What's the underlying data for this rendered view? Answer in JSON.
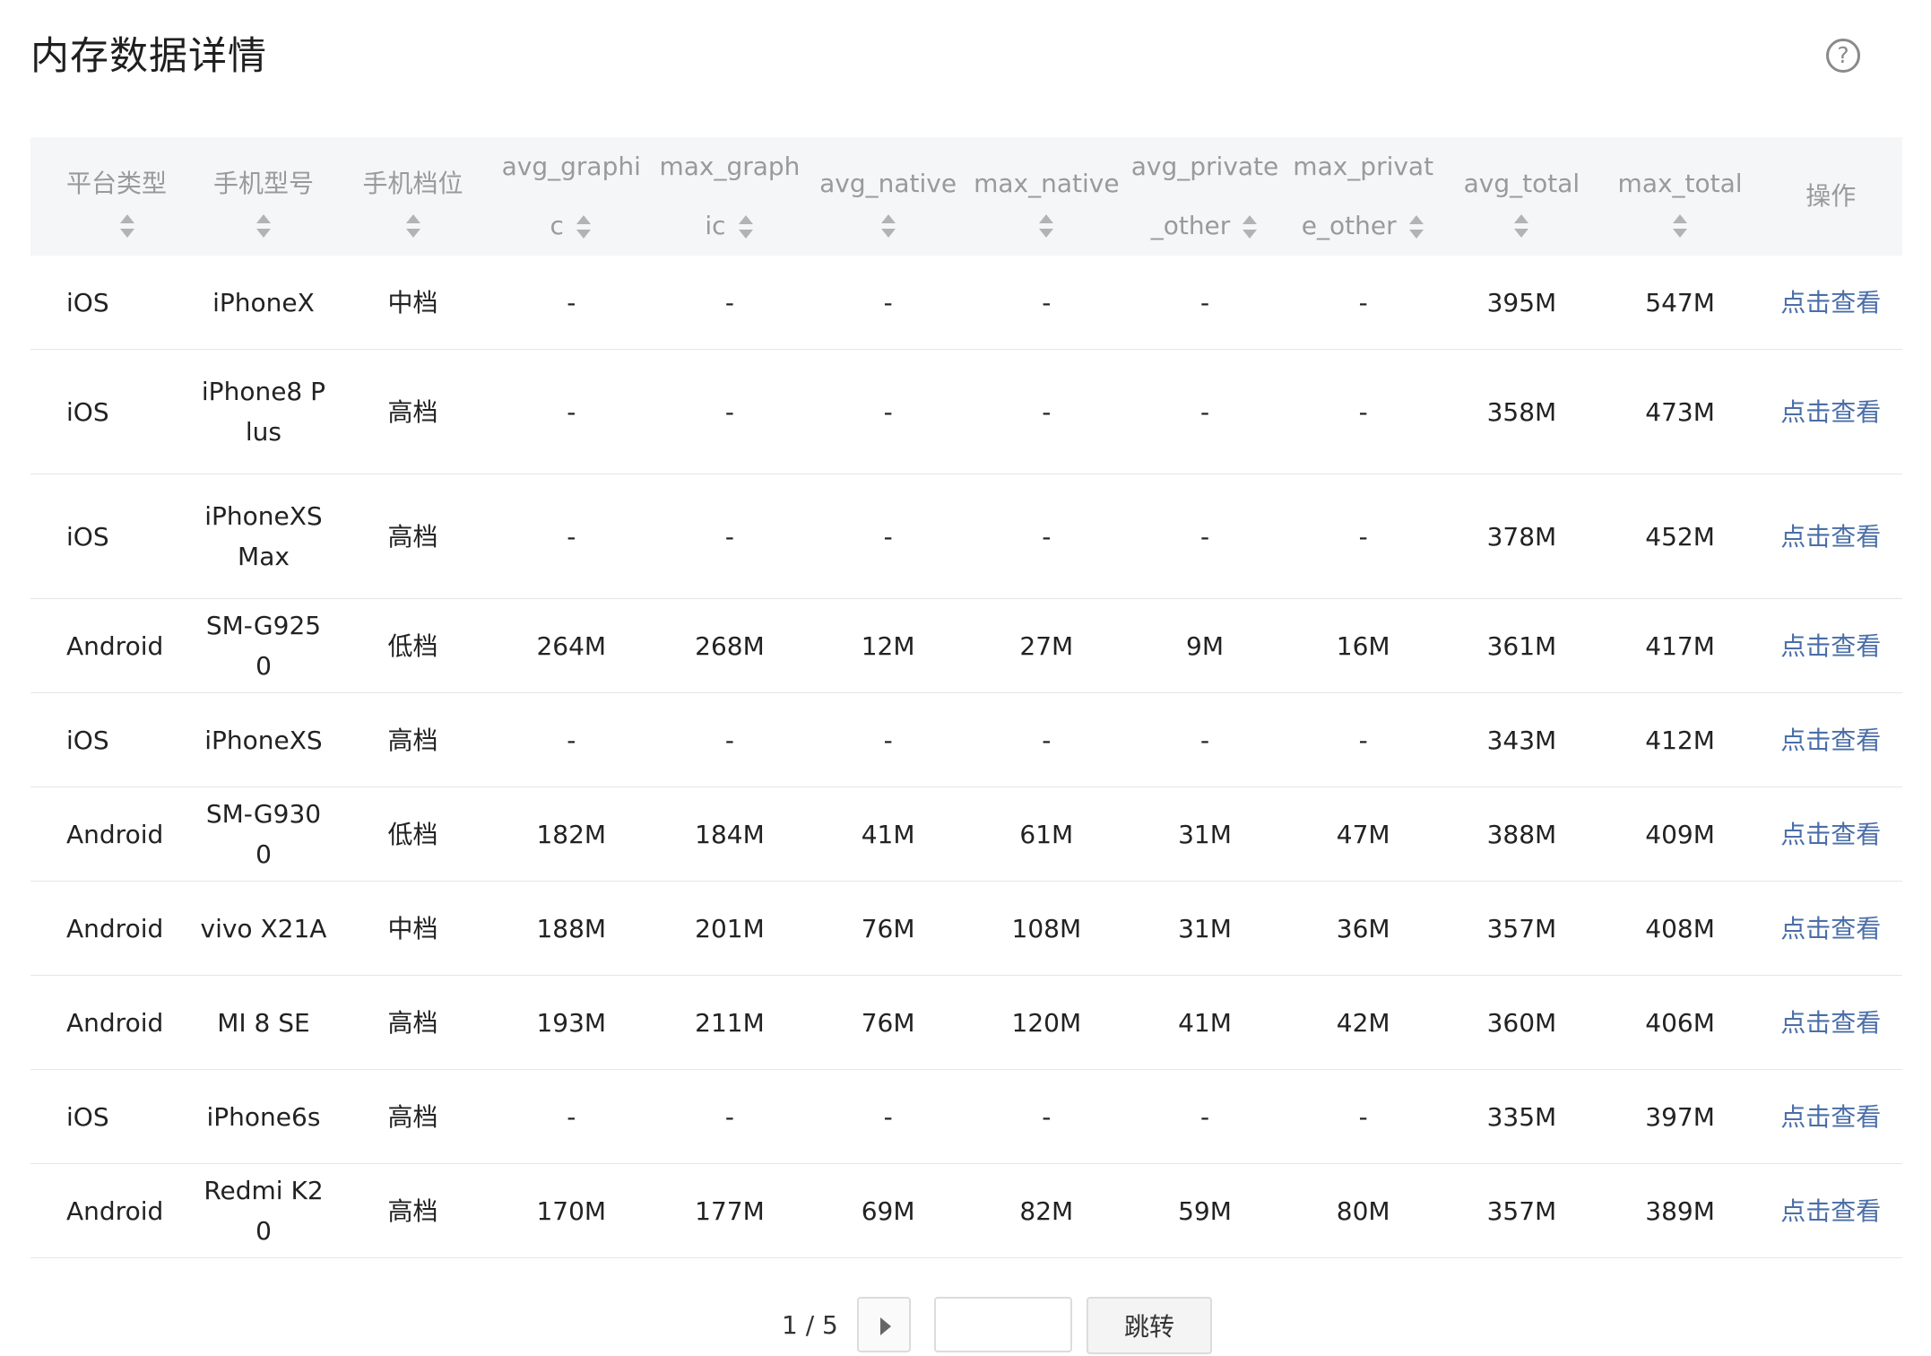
{
  "page": {
    "title": "内存数据详情"
  },
  "help_icon": {
    "glyph": "?"
  },
  "table": {
    "columns": [
      {
        "key": "platform",
        "label": "平台类型",
        "sortable": true
      },
      {
        "key": "model",
        "label": "手机型号",
        "sortable": true
      },
      {
        "key": "tier",
        "label": "手机档位",
        "sortable": true
      },
      {
        "key": "avg_graphic",
        "label": "avg_graphic",
        "sortable": true
      },
      {
        "key": "max_graphic",
        "label": "max_graphic",
        "sortable": true
      },
      {
        "key": "avg_native",
        "label": "avg_native",
        "sortable": true
      },
      {
        "key": "max_native",
        "label": "max_native",
        "sortable": true
      },
      {
        "key": "avg_private_other",
        "label": "avg_private_other",
        "sortable": true
      },
      {
        "key": "max_private_other",
        "label": "max_private_other",
        "sortable": true
      },
      {
        "key": "avg_total",
        "label": "avg_total",
        "sortable": true
      },
      {
        "key": "max_total",
        "label": "max_total",
        "sortable": true
      },
      {
        "key": "action",
        "label": "操作",
        "sortable": false
      }
    ],
    "rows": [
      [
        "iOS",
        "iPhoneX",
        "中档",
        "-",
        "-",
        "-",
        "-",
        "-",
        "-",
        "395M",
        "547M",
        "点击查看"
      ],
      [
        "iOS",
        "iPhone8 Plus",
        "高档",
        "-",
        "-",
        "-",
        "-",
        "-",
        "-",
        "358M",
        "473M",
        "点击查看"
      ],
      [
        "iOS",
        "iPhoneXS Max",
        "高档",
        "-",
        "-",
        "-",
        "-",
        "-",
        "-",
        "378M",
        "452M",
        "点击查看"
      ],
      [
        "Android",
        "SM-G9250",
        "低档",
        "264M",
        "268M",
        "12M",
        "27M",
        "9M",
        "16M",
        "361M",
        "417M",
        "点击查看"
      ],
      [
        "iOS",
        "iPhoneXS",
        "高档",
        "-",
        "-",
        "-",
        "-",
        "-",
        "-",
        "343M",
        "412M",
        "点击查看"
      ],
      [
        "Android",
        "SM-G9300",
        "低档",
        "182M",
        "184M",
        "41M",
        "61M",
        "31M",
        "47M",
        "388M",
        "409M",
        "点击查看"
      ],
      [
        "Android",
        "vivo X21A",
        "中档",
        "188M",
        "201M",
        "76M",
        "108M",
        "31M",
        "36M",
        "357M",
        "408M",
        "点击查看"
      ],
      [
        "Android",
        "MI 8 SE",
        "高档",
        "193M",
        "211M",
        "76M",
        "120M",
        "41M",
        "42M",
        "360M",
        "406M",
        "点击查看"
      ],
      [
        "iOS",
        "iPhone6s",
        "高档",
        "-",
        "-",
        "-",
        "-",
        "-",
        "-",
        "335M",
        "397M",
        "点击查看"
      ],
      [
        "Android",
        "Redmi K20",
        "高档",
        "170M",
        "177M",
        "69M",
        "82M",
        "59M",
        "80M",
        "357M",
        "389M",
        "点击查看"
      ]
    ]
  },
  "pagination": {
    "status": "1 / 5",
    "input_value": "",
    "jump_label": "跳转"
  },
  "colors": {
    "header_bg": "#f5f6f8",
    "link": "#4a6ea8",
    "row_divider": "#e6e6e6"
  }
}
